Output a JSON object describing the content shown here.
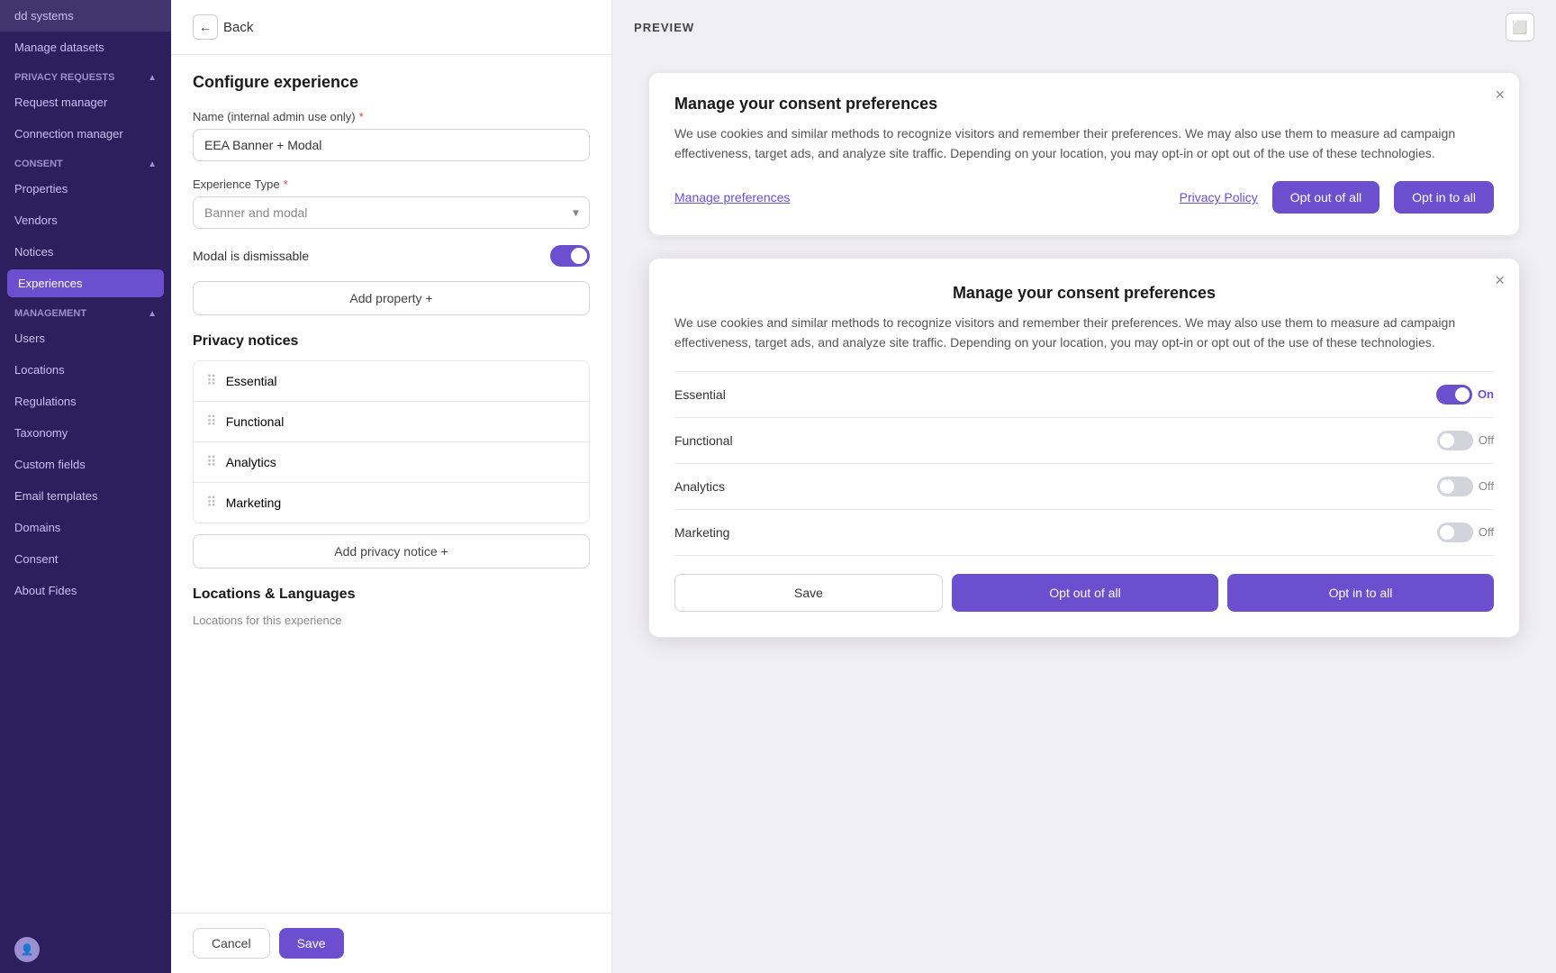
{
  "sidebar": {
    "items": [
      {
        "label": "dd systems",
        "active": false
      },
      {
        "label": "Manage datasets",
        "active": false
      }
    ],
    "sections": [
      {
        "header": "PRIVACY REQUESTS",
        "expanded": true,
        "items": [
          {
            "label": "Request manager",
            "active": false
          },
          {
            "label": "Connection manager",
            "active": false
          }
        ]
      },
      {
        "header": "CONSENT",
        "expanded": true,
        "items": [
          {
            "label": "Properties",
            "active": false
          },
          {
            "label": "Vendors",
            "active": false
          },
          {
            "label": "Notices",
            "active": false
          },
          {
            "label": "Experiences",
            "active": true
          }
        ]
      },
      {
        "header": "MANAGEMENT",
        "expanded": true,
        "items": [
          {
            "label": "Users",
            "active": false
          },
          {
            "label": "Locations",
            "active": false
          },
          {
            "label": "Regulations",
            "active": false
          },
          {
            "label": "Taxonomy",
            "active": false
          },
          {
            "label": "Custom fields",
            "active": false
          },
          {
            "label": "Email templates",
            "active": false
          },
          {
            "label": "Domains",
            "active": false
          },
          {
            "label": "Consent",
            "active": false
          },
          {
            "label": "About Fides",
            "active": false
          }
        ]
      }
    ]
  },
  "config": {
    "back_label": "Back",
    "title": "Configure experience",
    "name_label": "Name (internal admin use only)",
    "name_value": "EEA Banner + Modal",
    "name_placeholder": "EEA Banner + Modal",
    "experience_type_label": "Experience Type",
    "experience_type_value": "Banner and modal",
    "modal_dismissable_label": "Modal is dismissable",
    "add_property_label": "Add property +",
    "privacy_notices_title": "Privacy notices",
    "notices": [
      {
        "label": "Essential"
      },
      {
        "label": "Functional"
      },
      {
        "label": "Analytics"
      },
      {
        "label": "Marketing"
      }
    ],
    "add_notice_label": "Add privacy notice +",
    "locations_title": "Locations & Languages",
    "locations_sub": "Locations for this experience",
    "cancel_label": "Cancel",
    "save_label": "Save"
  },
  "preview": {
    "title": "PREVIEW",
    "device_icon": "📱",
    "banner": {
      "title": "Manage your consent preferences",
      "description": "We use cookies and similar methods to recognize visitors and remember their preferences. We may also use them to measure ad campaign effectiveness, target ads, and analyze site traffic. Depending on your location, you may opt-in or opt out of the use of these technologies.",
      "manage_link": "Manage preferences",
      "policy_link": "Privacy Policy",
      "opt_out_label": "Opt out of all",
      "opt_in_label": "Opt in to all"
    },
    "modal": {
      "title": "Manage your consent preferences",
      "description": "We use cookies and similar methods to recognize visitors and remember their preferences. We may also use them to measure ad campaign effectiveness, target ads, and analyze site traffic. Depending on your location, you may opt-in or opt out of the use of these technologies.",
      "preferences": [
        {
          "label": "Essential",
          "state": "on",
          "state_label": "On"
        },
        {
          "label": "Functional",
          "state": "off",
          "state_label": "Off"
        },
        {
          "label": "Analytics",
          "state": "off",
          "state_label": "Off"
        },
        {
          "label": "Marketing",
          "state": "off",
          "state_label": "Off"
        }
      ],
      "save_label": "Save",
      "opt_out_label": "Opt out of all",
      "opt_in_label": "Opt in to all"
    }
  }
}
